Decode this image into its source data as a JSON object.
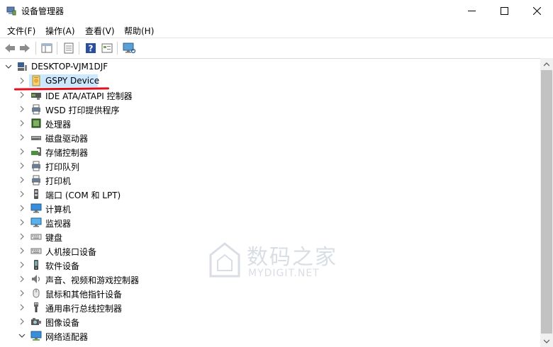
{
  "window": {
    "title": "设备管理器"
  },
  "menu": [
    "文件(F)",
    "操作(A)",
    "查看(V)",
    "帮助(H)"
  ],
  "toolbar": [
    "back-icon",
    "forward-icon",
    "show-hide-tree-icon",
    "properties-icon",
    "help-icon",
    "view-icon",
    "monitor-scan-icon"
  ],
  "tree": {
    "root": "DESKTOP-VJM1DJF",
    "items": [
      {
        "label": "GSPY Device",
        "icon": "gspy-device-icon",
        "expanded": false,
        "selected": true
      },
      {
        "label": "IDE ATA/ATAPI 控制器",
        "icon": "ide-controller-icon",
        "expanded": false
      },
      {
        "label": "WSD 打印提供程序",
        "icon": "printer-provider-icon",
        "expanded": false
      },
      {
        "label": "处理器",
        "icon": "processor-icon",
        "expanded": false
      },
      {
        "label": "磁盘驱动器",
        "icon": "disk-drive-icon",
        "expanded": false
      },
      {
        "label": "存储控制器",
        "icon": "storage-controller-icon",
        "expanded": false
      },
      {
        "label": "打印队列",
        "icon": "print-queue-icon",
        "expanded": false
      },
      {
        "label": "打印机",
        "icon": "printer-icon",
        "expanded": false
      },
      {
        "label": "端口 (COM 和 LPT)",
        "icon": "port-icon",
        "expanded": false
      },
      {
        "label": "计算机",
        "icon": "computer-icon",
        "expanded": false
      },
      {
        "label": "监视器",
        "icon": "monitor-icon",
        "expanded": false
      },
      {
        "label": "键盘",
        "icon": "keyboard-icon",
        "expanded": false
      },
      {
        "label": "人机接口设备",
        "icon": "hid-icon",
        "expanded": false
      },
      {
        "label": "软件设备",
        "icon": "software-device-icon",
        "expanded": false
      },
      {
        "label": "声音、视频和游戏控制器",
        "icon": "speaker-icon",
        "expanded": false
      },
      {
        "label": "鼠标和其他指针设备",
        "icon": "mouse-icon",
        "expanded": false
      },
      {
        "label": "通用串行总线控制器",
        "icon": "usb-icon",
        "expanded": false
      },
      {
        "label": "图像设备",
        "icon": "camera-icon",
        "expanded": false
      },
      {
        "label": "网络适配器",
        "icon": "network-adapter-icon",
        "expanded": true
      }
    ]
  },
  "watermark": {
    "line1": "数码之家",
    "line2": "MYDIGIT.NET"
  },
  "colors": {
    "selection": "#cce8ff",
    "annotation_underline": "#e0101e"
  }
}
